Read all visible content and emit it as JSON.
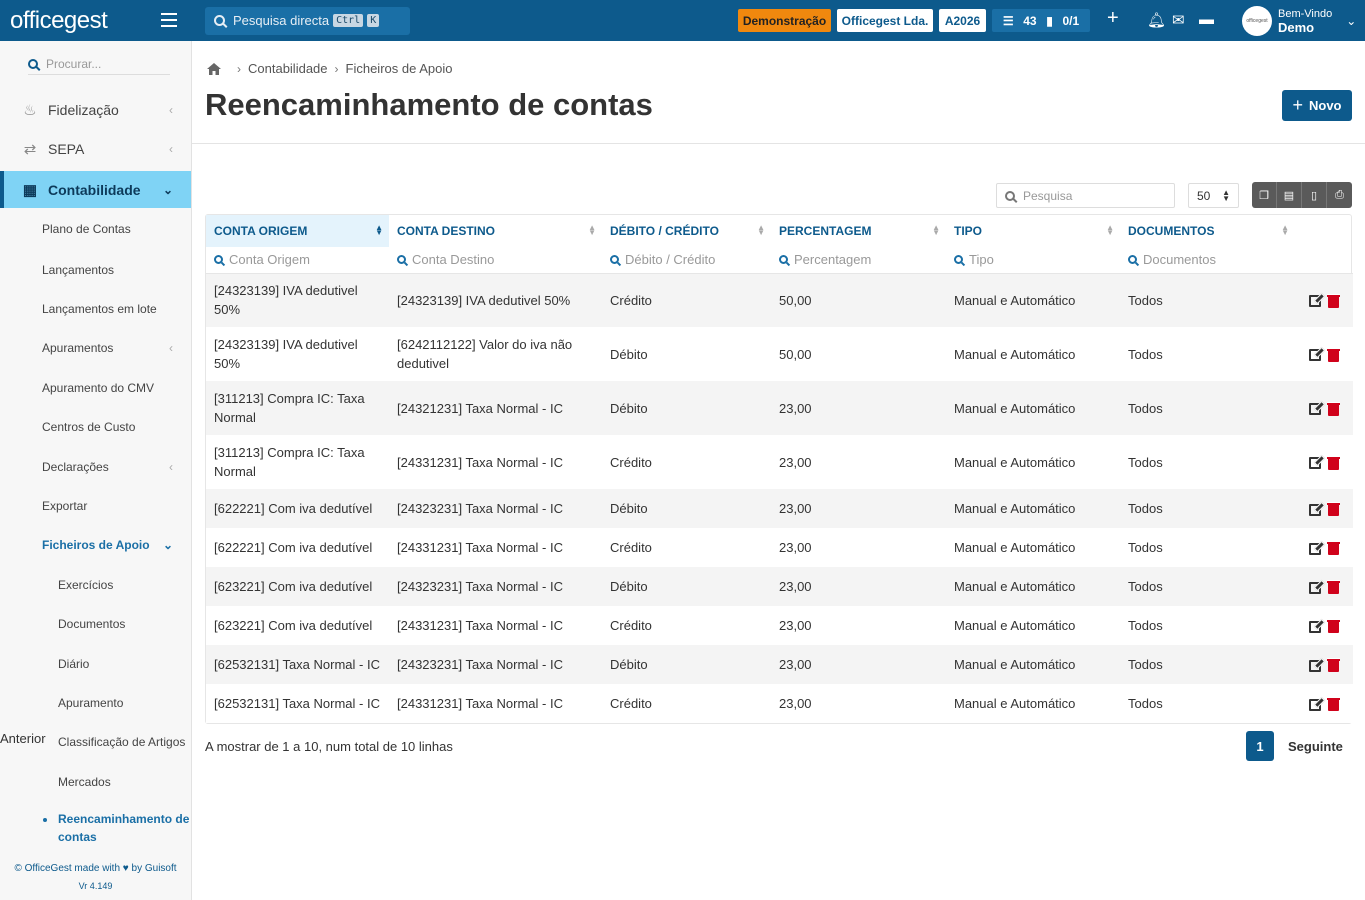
{
  "topbar": {
    "logo_text": "officegest",
    "search_placeholder": "Pesquisa directa",
    "shortcut_ctrl": "Ctrl",
    "shortcut_key": "K",
    "demo_label": "Demonstração",
    "company_label": "Officegest Lda.",
    "year_label": "A2026",
    "tasks_count": "43",
    "docs_count": "0/1",
    "add_icon": "+",
    "welcome": "Bem-Vindo",
    "user_name": "Demo"
  },
  "sidebar": {
    "search_placeholder": "Procurar...",
    "items": [
      {
        "label": "Fidelização",
        "icon": "hand-coin-icon"
      },
      {
        "label": "SEPA",
        "icon": "arrows-exchange-icon"
      },
      {
        "label": "Contabilidade",
        "icon": "calculator-icon"
      }
    ],
    "sub_items": [
      "Plano de Contas",
      "Lançamentos",
      "Lançamentos em lote",
      "Apuramentos",
      "Apuramento do CMV",
      "Centros de Custo",
      "Declarações",
      "Exportar",
      "Ficheiros de Apoio"
    ],
    "sub_sub_items": [
      "Exercícios",
      "Documentos",
      "Diário",
      "Apuramento",
      "Classificação de Artigos",
      "Mercados",
      "Reencaminhamento de contas"
    ],
    "footer_before": "© OfficeGest made with",
    "footer_after": "by Guisoft",
    "version": "Vr 4.149"
  },
  "breadcrumb": {
    "level1": "Contabilidade",
    "level2": "Ficheiros de Apoio"
  },
  "page": {
    "title": "Reencaminhamento de contas",
    "new_button": "Novo"
  },
  "table": {
    "search_placeholder": "Pesquisa",
    "page_size": "50",
    "columns": [
      "CONTA ORIGEM",
      "CONTA DESTINO",
      "DÉBITO / CRÉDITO",
      "PERCENTAGEM",
      "TIPO",
      "DOCUMENTOS"
    ],
    "filters": [
      "Conta Origem",
      "Conta Destino",
      "Débito / Crédito",
      "Percentagem",
      "Tipo",
      "Documentos"
    ],
    "rows": [
      [
        "[24323139] IVA dedutivel 50%",
        "[24323139] IVA dedutivel 50%",
        "Crédito",
        "50,00",
        "Manual e Automático",
        "Todos"
      ],
      [
        "[24323139] IVA dedutivel 50%",
        "[6242112122] Valor do iva não dedutivel",
        "Débito",
        "50,00",
        "Manual e Automático",
        "Todos"
      ],
      [
        "[311213] Compra IC: Taxa Normal",
        "[24321231] Taxa Normal - IC",
        "Débito",
        "23,00",
        "Manual e Automático",
        "Todos"
      ],
      [
        "[311213] Compra IC: Taxa Normal",
        "[24331231] Taxa Normal - IC",
        "Crédito",
        "23,00",
        "Manual e Automático",
        "Todos"
      ],
      [
        "[622221] Com iva dedutível",
        "[24323231] Taxa Normal - IC",
        "Débito",
        "23,00",
        "Manual e Automático",
        "Todos"
      ],
      [
        "[622221] Com iva dedutível",
        "[24331231] Taxa Normal - IC",
        "Crédito",
        "23,00",
        "Manual e Automático",
        "Todos"
      ],
      [
        "[623221] Com iva dedutível",
        "[24323231] Taxa Normal - IC",
        "Débito",
        "23,00",
        "Manual e Automático",
        "Todos"
      ],
      [
        "[623221] Com iva dedutível",
        "[24331231] Taxa Normal - IC",
        "Crédito",
        "23,00",
        "Manual e Automático",
        "Todos"
      ],
      [
        "[62532131] Taxa Normal - IC",
        "[24323231] Taxa Normal - IC",
        "Débito",
        "23,00",
        "Manual e Automático",
        "Todos"
      ],
      [
        "[62532131] Taxa Normal - IC",
        "[24331231] Taxa Normal - IC",
        "Crédito",
        "23,00",
        "Manual e Automático",
        "Todos"
      ]
    ],
    "info": "A mostrar de 1 a 10, num total de 10 linhas",
    "prev_label": "Anterior",
    "current_page": "1",
    "next_label": "Seguinte"
  },
  "colors": {
    "brand": "#0d5a8c",
    "accent_active": "#7fd3f5",
    "demo_badge": "#f0880e",
    "delete": "#d0021b"
  }
}
